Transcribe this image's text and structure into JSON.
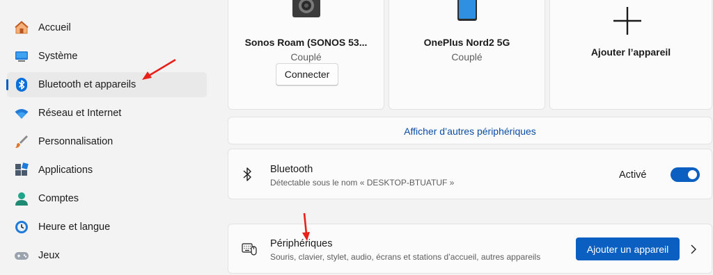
{
  "sidebar": {
    "items": [
      {
        "label": "Accueil",
        "icon": "home-icon"
      },
      {
        "label": "Système",
        "icon": "monitor-icon"
      },
      {
        "label": "Bluetooth et appareils",
        "icon": "bluetooth-icon",
        "selected": true
      },
      {
        "label": "Réseau et Internet",
        "icon": "wifi-icon"
      },
      {
        "label": "Personnalisation",
        "icon": "brush-icon"
      },
      {
        "label": "Applications",
        "icon": "apps-icon"
      },
      {
        "label": "Comptes",
        "icon": "person-icon"
      },
      {
        "label": "Heure et langue",
        "icon": "clock-globe-icon"
      },
      {
        "label": "Jeux",
        "icon": "gamepad-icon"
      }
    ]
  },
  "devices": [
    {
      "name": "Sonos Roam (SONOS 53...",
      "status": "Couplé",
      "action": "Connecter",
      "icon": "speaker-icon"
    },
    {
      "name": "OnePlus Nord2 5G",
      "status": "Couplé",
      "icon": "phone-icon"
    },
    {
      "name": "Ajouter l’appareil",
      "icon": "plus-icon"
    }
  ],
  "more_devices_link": "Afficher d’autres périphériques",
  "bluetooth": {
    "title": "Bluetooth",
    "subtitle": "Détectable sous le nom « DESKTOP-BTUATUF »",
    "state_label": "Activé",
    "enabled": true
  },
  "peripherals": {
    "title": "Périphériques",
    "subtitle": "Souris, clavier, stylet, audio, écrans et stations d’accueil, autres appareils",
    "button": "Ajouter un appareil"
  },
  "colors": {
    "accent": "#0a5fc1",
    "link": "#0a4ca3",
    "annotation": "#e8201a"
  }
}
